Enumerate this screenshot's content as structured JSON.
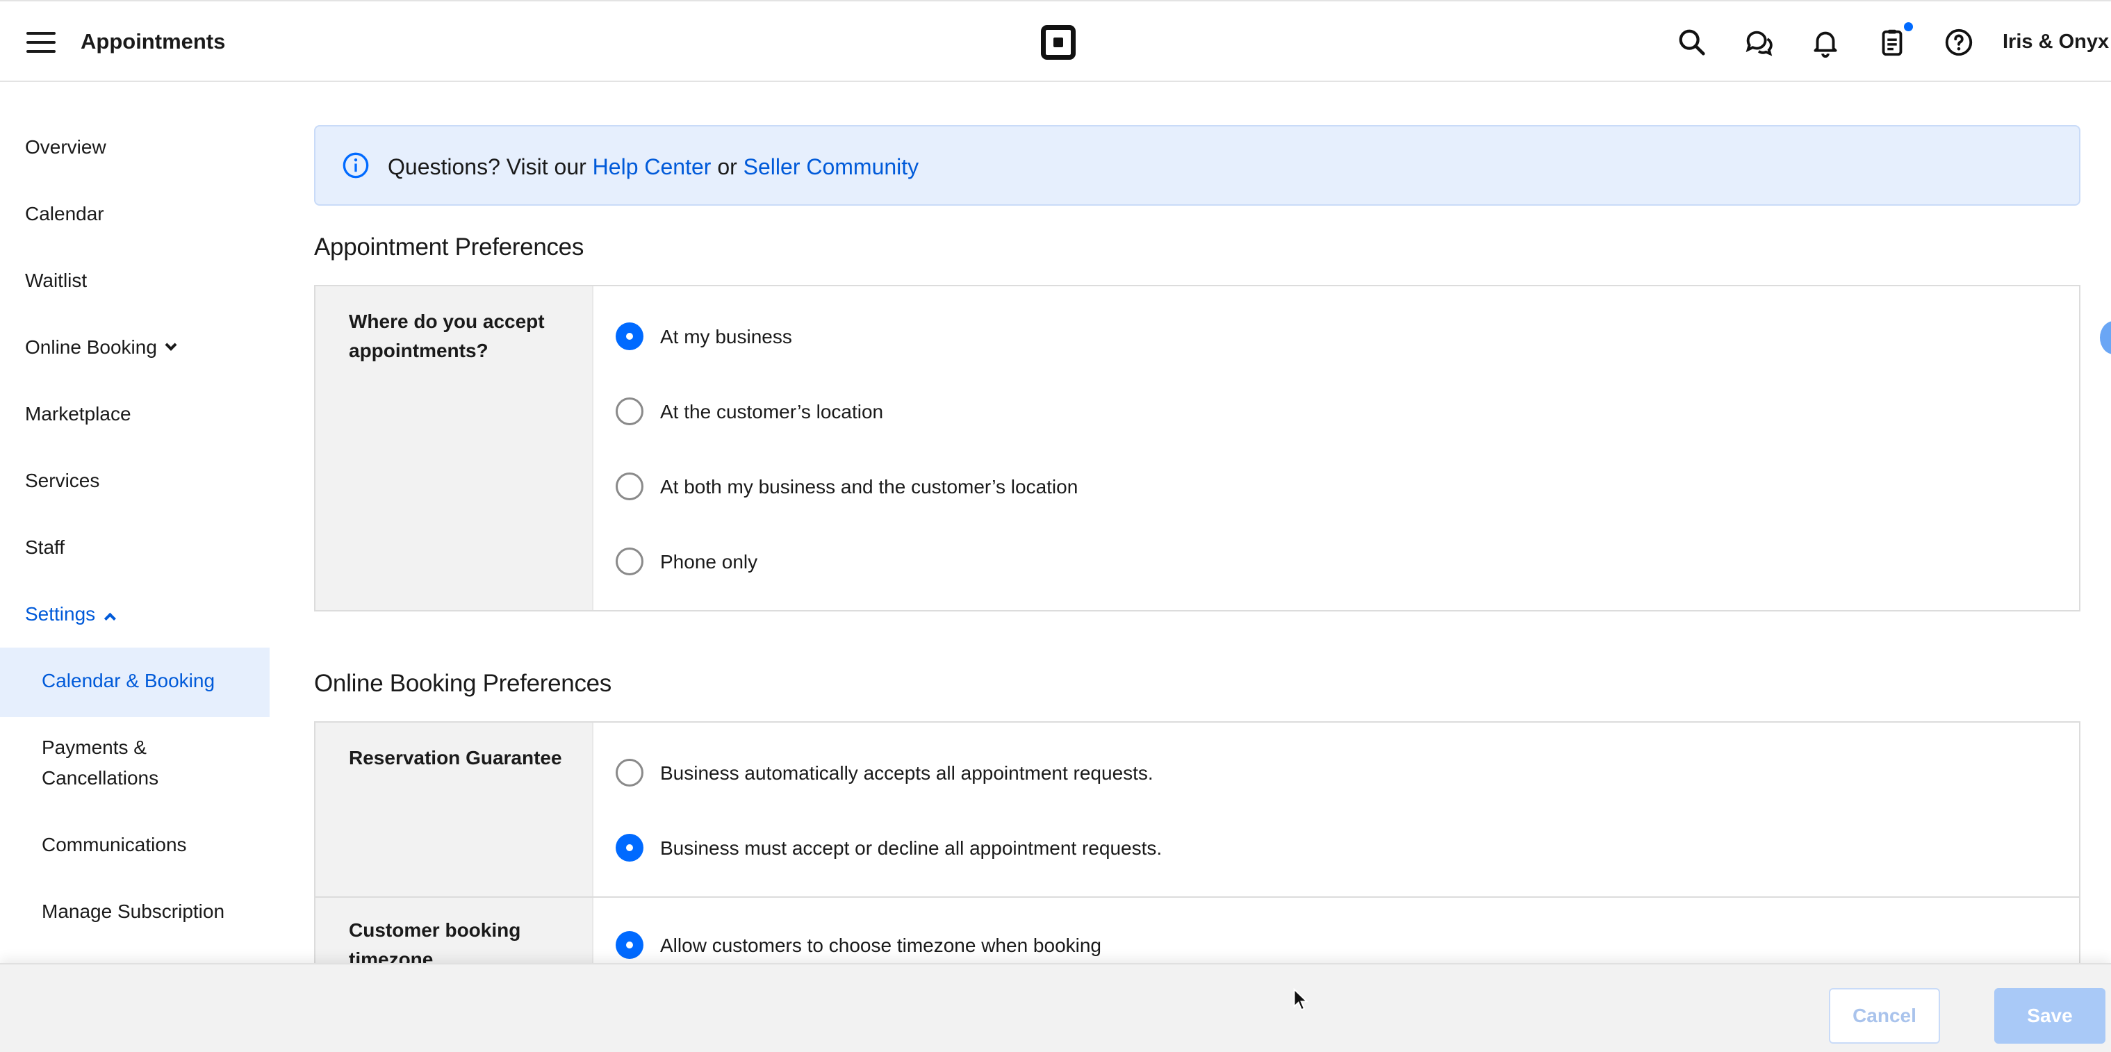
{
  "header": {
    "title": "Appointments",
    "business_name": "Iris & Onyx",
    "icons": [
      "menu-icon",
      "square-logo-icon",
      "search-icon",
      "messages-icon",
      "bell-icon",
      "clipboard-icon",
      "help-icon"
    ]
  },
  "sidebar": {
    "items": [
      {
        "label": "Overview"
      },
      {
        "label": "Calendar"
      },
      {
        "label": "Waitlist"
      },
      {
        "label": "Online Booking"
      },
      {
        "label": "Marketplace"
      },
      {
        "label": "Services"
      },
      {
        "label": "Staff"
      },
      {
        "label": "Settings"
      }
    ],
    "subitems": [
      {
        "label": "Calendar & Booking",
        "active": true
      },
      {
        "label": "Payments & Cancellations"
      },
      {
        "label": "Communications"
      },
      {
        "label": "Manage Subscription"
      }
    ]
  },
  "banner": {
    "prefix": "Questions? Visit our ",
    "help_center": "Help Center",
    "or": " or ",
    "seller_community": "Seller Community"
  },
  "appointment_preferences": {
    "title": "Appointment Preferences",
    "question": "Where do you accept appointments?",
    "options": [
      {
        "label": "At my business",
        "selected": true
      },
      {
        "label": "At the customer’s location",
        "selected": false
      },
      {
        "label": "At both my business and the customer’s location",
        "selected": false
      },
      {
        "label": "Phone only",
        "selected": false
      }
    ]
  },
  "online_booking_preferences": {
    "title": "Online Booking Preferences",
    "reservation": {
      "label": "Reservation Guarantee",
      "options": [
        {
          "label": "Business automatically accepts all appointment requests.",
          "selected": false
        },
        {
          "label": "Business must accept or decline all appointment requests.",
          "selected": true
        }
      ]
    },
    "timezone": {
      "label": "Customer booking timezone",
      "options": [
        {
          "label": "Allow customers to choose timezone when booking",
          "selected": true
        }
      ]
    }
  },
  "footer": {
    "cancel": "Cancel",
    "save": "Save"
  },
  "colors": {
    "accent": "#006aff",
    "link": "#005ad9",
    "banner_bg": "#e6effd"
  }
}
